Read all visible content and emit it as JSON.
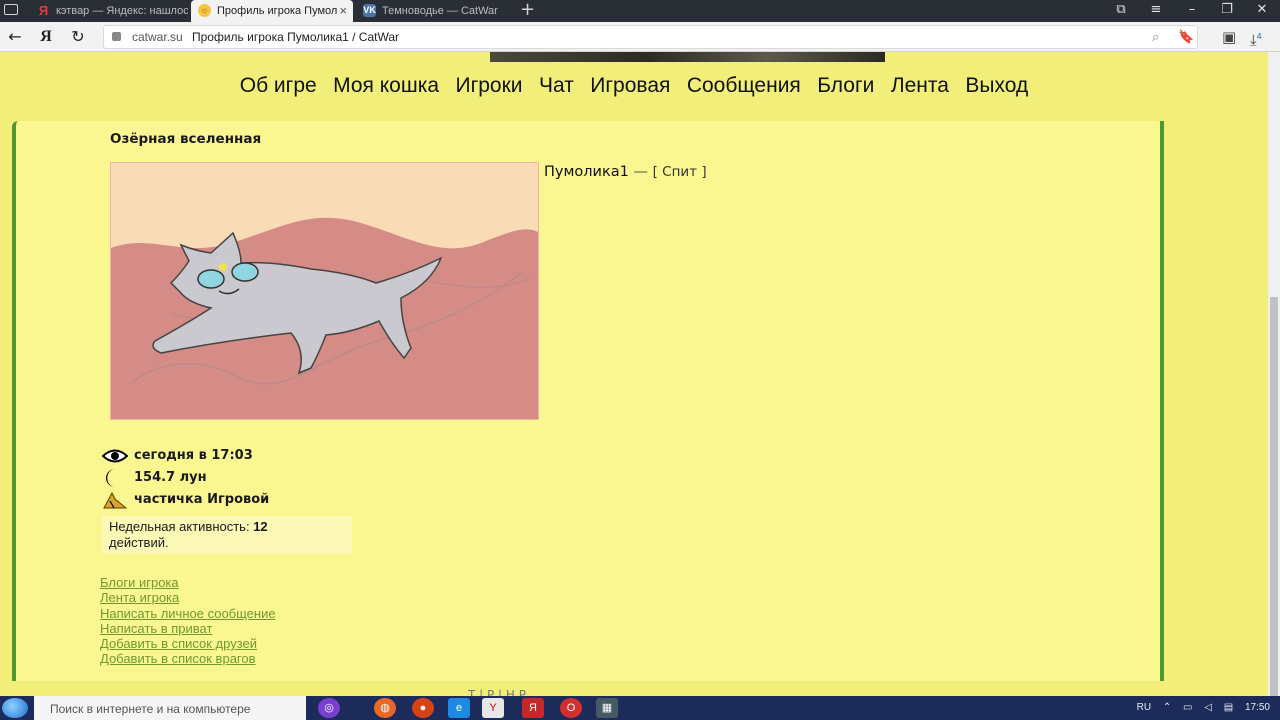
{
  "browser": {
    "tabs": [
      {
        "label": "кэтвар — Яндекс: нашлось",
        "icon": "yandex-icon"
      },
      {
        "label": "Профиль игрока Пумол",
        "icon": "catwar-icon"
      },
      {
        "label": "Темноводье — CatWar",
        "icon": "vk-icon"
      }
    ],
    "new_tab": "+",
    "address": {
      "domain": "catwar.su",
      "page_title": "Профиль игрока Пумолика1 / CatWar"
    },
    "back": "←",
    "refresh": "↻",
    "yandex_logo": "Я",
    "downloads_count": "4"
  },
  "site": {
    "nav": [
      "Об игре",
      "Моя кошка",
      "Игроки",
      "Чат",
      "Игровая",
      "Сообщения",
      "Блоги",
      "Лента",
      "Выход"
    ],
    "world_title": "Озёрная вселенная",
    "player": {
      "name": "Пумолика1",
      "dash": "—",
      "status": "[ Спит ]"
    },
    "stats": {
      "last_seen": "сегодня в 17:03",
      "age": "154.7 лун",
      "group": "частичка Игровой"
    },
    "activity": {
      "label": "Недельная активность:",
      "value": "12",
      "suffix": "действий."
    },
    "links": [
      "Блоги игрока",
      "Лента игрока",
      "Написать личное сообщение",
      "Написать в приват",
      "Добавить в список друзей",
      "Добавить в список врагов"
    ],
    "footer_text": "Т                                   | Р                    | Н  Р"
  },
  "taskbar": {
    "search_placeholder": "Поиск в интернете и на компьютере",
    "lang": "RU",
    "time": "17:50"
  },
  "colors": {
    "page_bg": "#f1ee7a",
    "content_bg": "#fbf790",
    "frame_border": "#4f9a2e",
    "link": "#6e9a2f"
  }
}
